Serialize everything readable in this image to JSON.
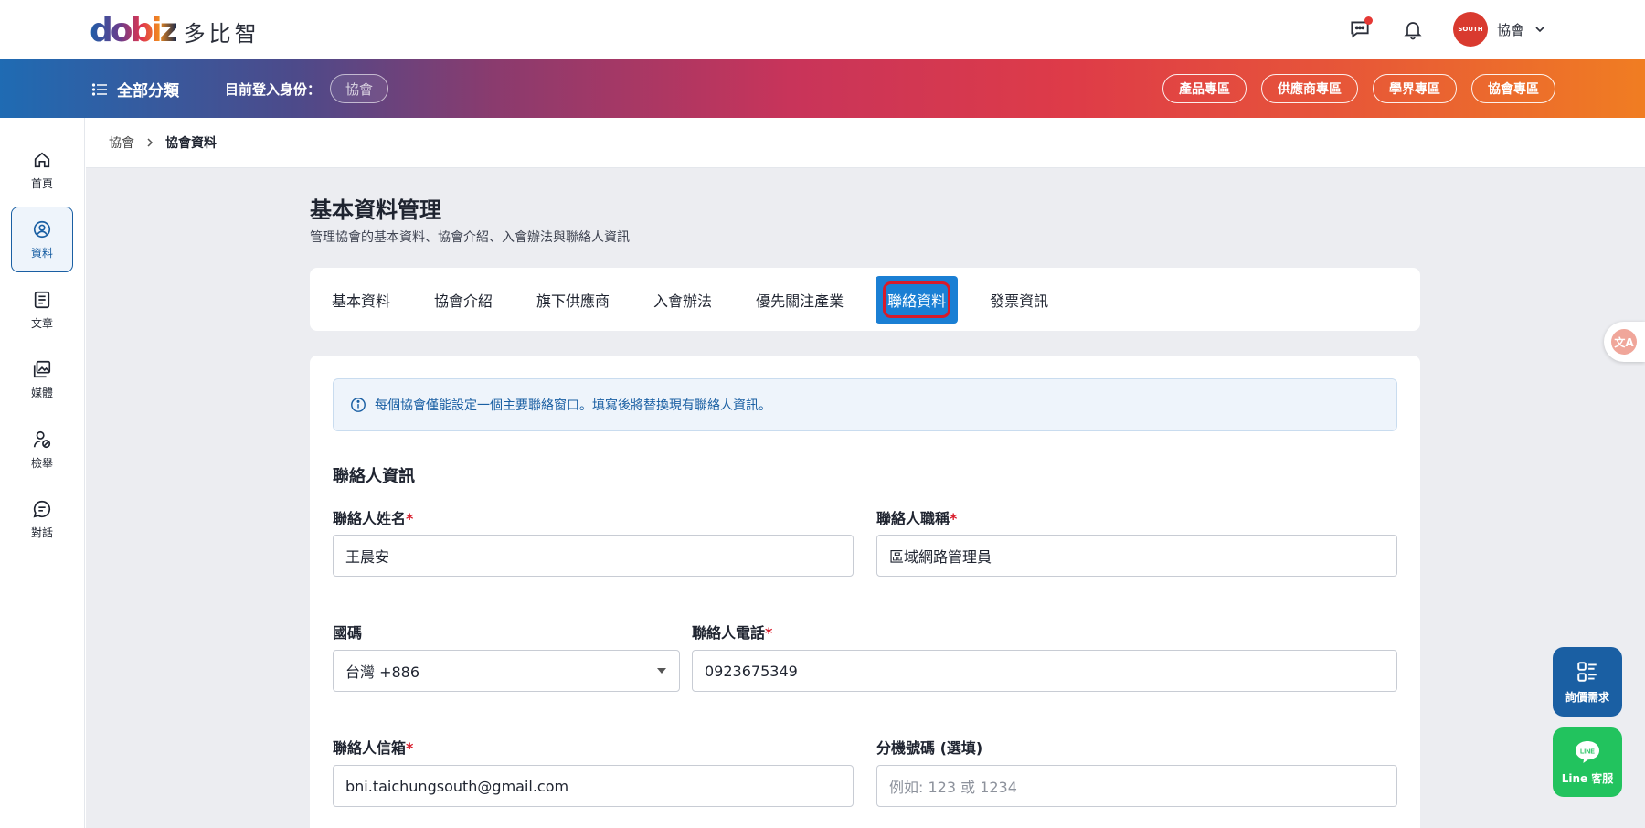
{
  "brand": {
    "logo_mark": "dobiz",
    "logo_text": "多比智"
  },
  "header": {
    "user_name": "協會",
    "avatar_text": "SOUTH"
  },
  "nav": {
    "all_categories": "全部分類",
    "identity_label": "目前登入身份：",
    "identity_value": "協會",
    "zones": [
      "產品專區",
      "供應商專區",
      "學界專區",
      "協會專區"
    ]
  },
  "sidebar": {
    "items": [
      {
        "label": "首頁",
        "icon": "home-icon"
      },
      {
        "label": "資料",
        "icon": "profile-icon"
      },
      {
        "label": "文章",
        "icon": "article-icon"
      },
      {
        "label": "媒體",
        "icon": "media-icon"
      },
      {
        "label": "檢舉",
        "icon": "report-icon"
      },
      {
        "label": "對話",
        "icon": "chat-icon"
      }
    ],
    "active_index": 1
  },
  "breadcrumb": {
    "parent": "協會",
    "current": "協會資料"
  },
  "page": {
    "title": "基本資料管理",
    "subtitle": "管理協會的基本資料、協會介紹、入會辦法與聯絡人資訊"
  },
  "tabs": [
    "基本資料",
    "協會介紹",
    "旗下供應商",
    "入會辦法",
    "優先關注產業",
    "聯絡資料",
    "發票資訊"
  ],
  "active_tab": "聯絡資料",
  "notice": "每個協會僅能設定一個主要聯絡窗口。填寫後將替換現有聯絡人資訊。",
  "contact": {
    "section_title": "聯絡人資訊",
    "name_label": "聯絡人姓名",
    "name_value": "王晨安",
    "title_label": "聯絡人職稱",
    "title_value": "區域網路管理員",
    "country_label": "國碼",
    "country_value": "台灣 +886",
    "phone_label": "聯絡人電話",
    "phone_value": "0923675349",
    "email_label": "聯絡人信箱",
    "email_value": "bni.taichungsouth@gmail.com",
    "ext_label": "分機號碼 (選填)",
    "ext_placeholder": "例如: 123 或 1234",
    "required_mark": "*"
  },
  "floating": {
    "quote_label": "詢價需求",
    "line_label": "Line 客服",
    "line_badge": "LINE",
    "translate_badge": "文A"
  },
  "colors": {
    "primary": "#1a5fa3",
    "tab_active": "#1a7fd4",
    "required": "#d81b2a",
    "line_green": "#22c35e"
  }
}
